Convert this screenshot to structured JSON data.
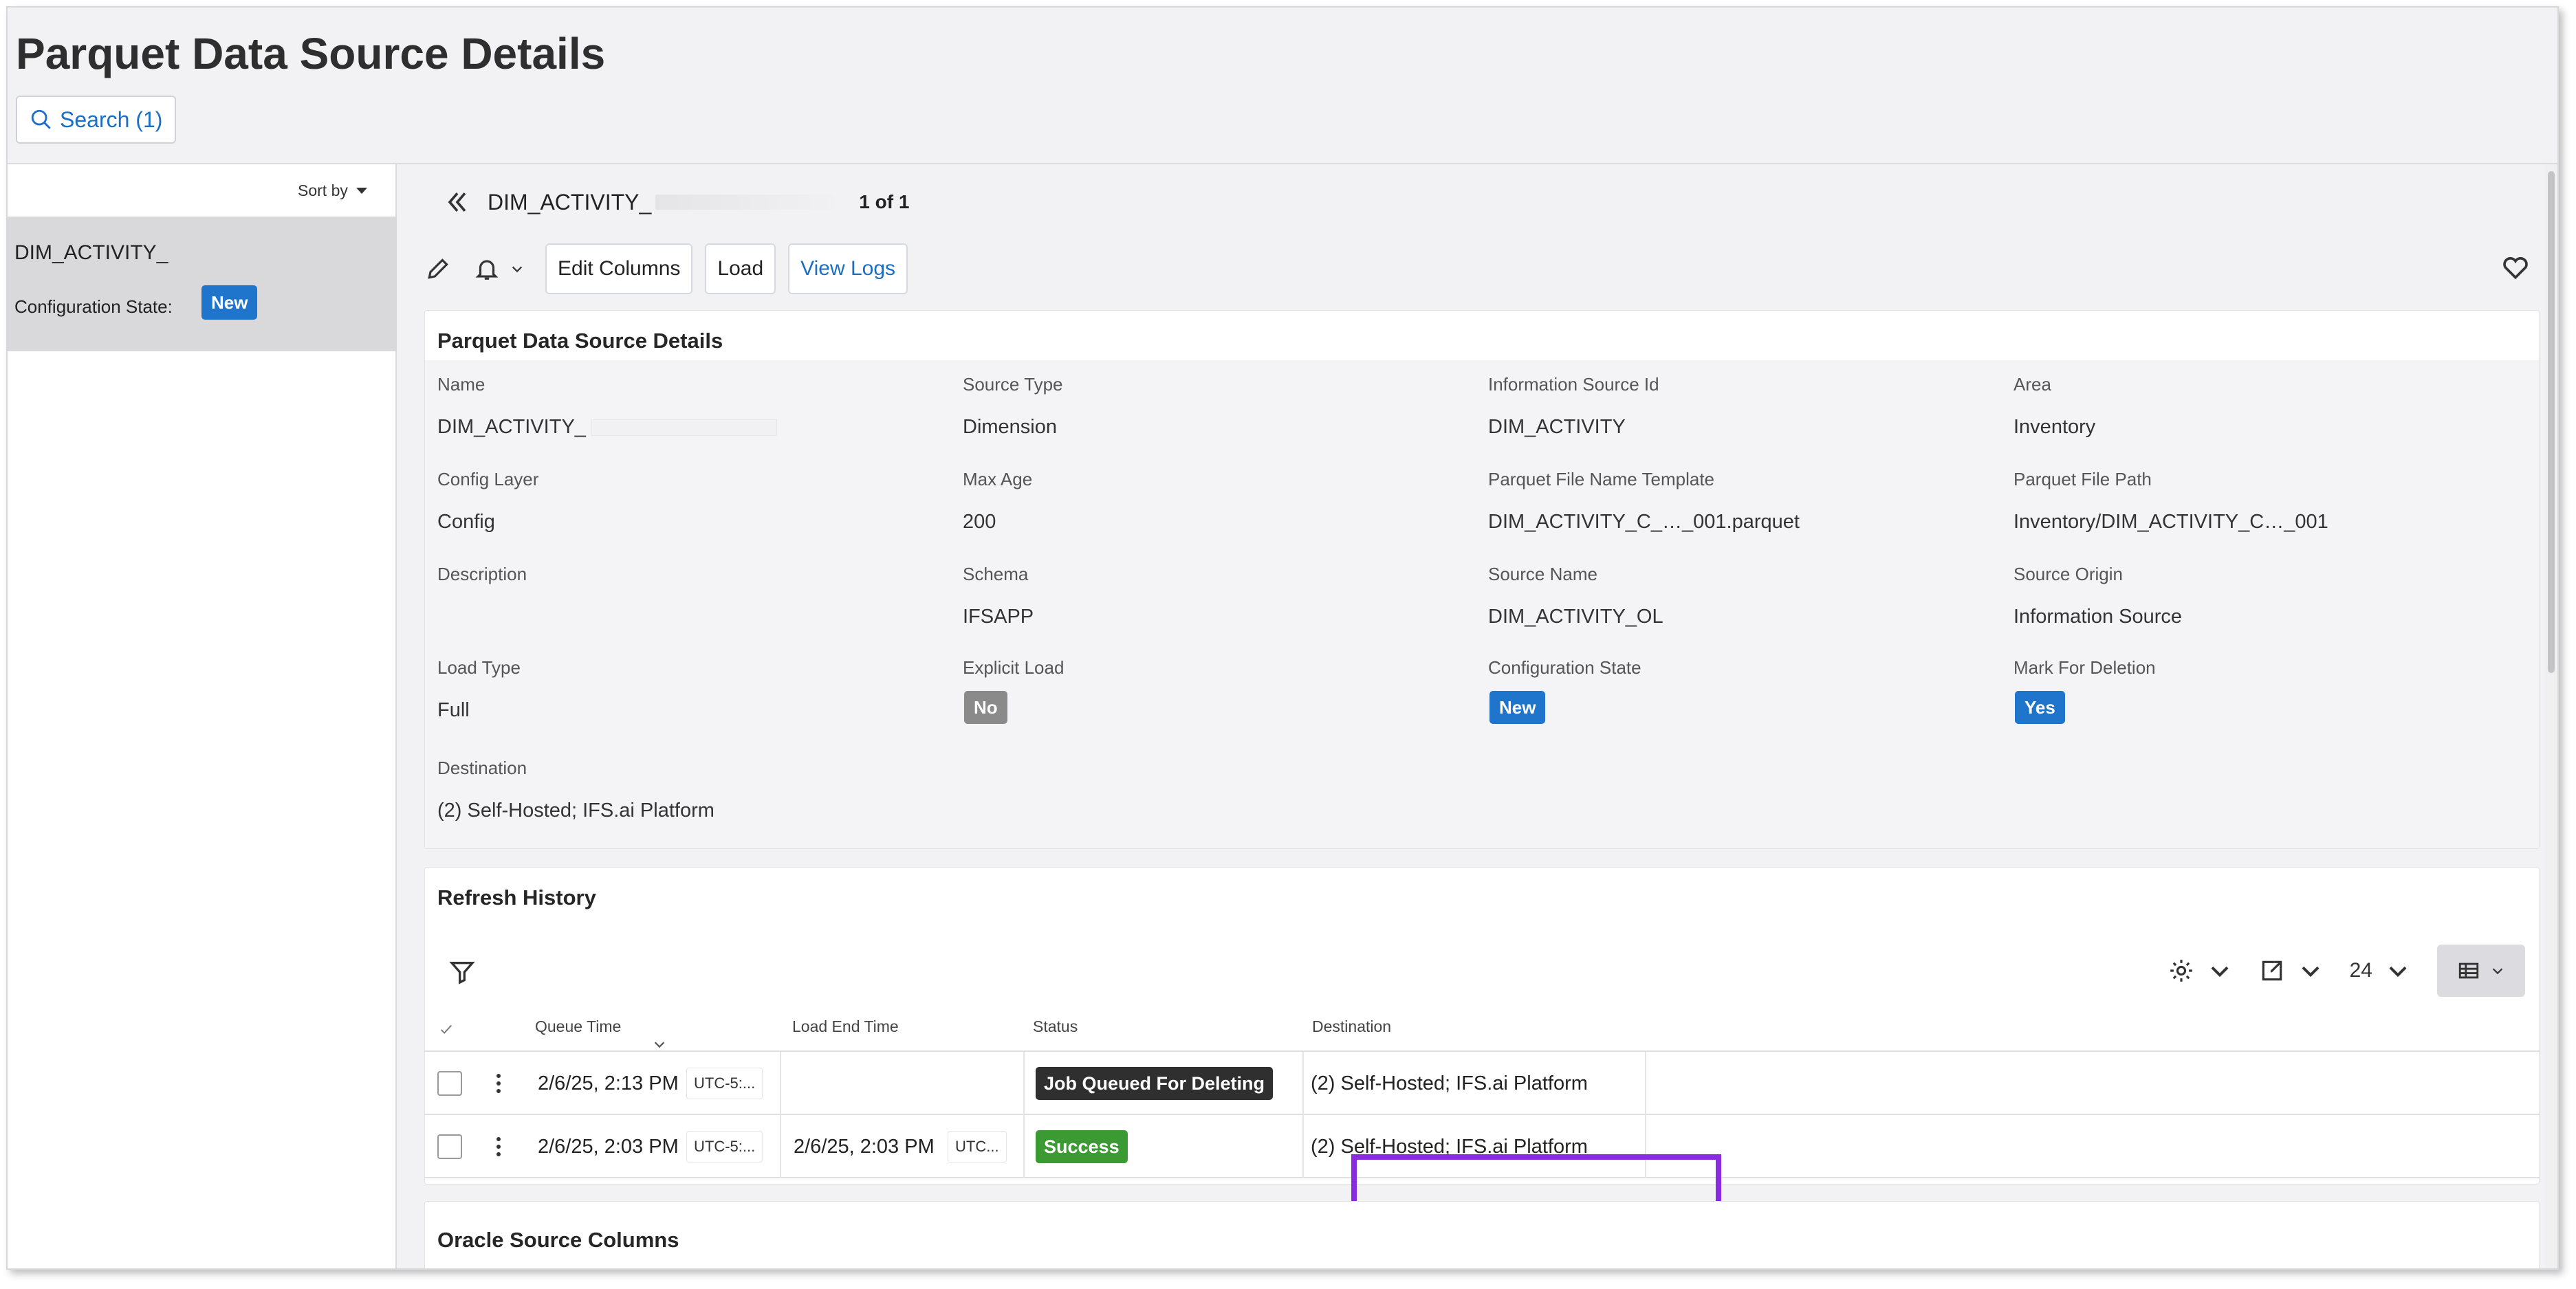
{
  "page": {
    "title": "Parquet Data Source Details",
    "search_label": "Search (1)"
  },
  "left_panel": {
    "sort_label": "Sort by",
    "items": [
      {
        "name": "DIM_ACTIVITY_",
        "state_label": "Configuration State:",
        "state_value": "New"
      }
    ]
  },
  "record_nav": {
    "record_name": "DIM_ACTIVITY_",
    "pager": "1 of 1"
  },
  "toolbar": {
    "edit_columns": "Edit Columns",
    "load": "Load",
    "view_logs": "View Logs"
  },
  "details": {
    "title": "Parquet Data Source Details",
    "fields": {
      "name": {
        "label": "Name",
        "value": "DIM_ACTIVITY_"
      },
      "source_type": {
        "label": "Source Type",
        "value": "Dimension"
      },
      "information_source_id": {
        "label": "Information Source Id",
        "value": "DIM_ACTIVITY"
      },
      "area": {
        "label": "Area",
        "value": "Inventory"
      },
      "config_layer": {
        "label": "Config Layer",
        "value": "Config"
      },
      "max_age": {
        "label": "Max Age",
        "value": "200"
      },
      "parquet_file_name_template": {
        "label": "Parquet File Name Template",
        "value": "DIM_ACTIVITY_C_…_001.parquet"
      },
      "parquet_file_path": {
        "label": "Parquet File Path",
        "value": "Inventory/DIM_ACTIVITY_C…_001"
      },
      "description": {
        "label": "Description",
        "value": ""
      },
      "schema": {
        "label": "Schema",
        "value": "IFSAPP"
      },
      "source_name": {
        "label": "Source Name",
        "value": "DIM_ACTIVITY_OL"
      },
      "source_origin": {
        "label": "Source Origin",
        "value": "Information Source"
      },
      "load_type": {
        "label": "Load Type",
        "value": "Full"
      },
      "explicit_load": {
        "label": "Explicit Load",
        "value": "No"
      },
      "configuration_state": {
        "label": "Configuration State",
        "value": "New"
      },
      "mark_for_deletion": {
        "label": "Mark For Deletion",
        "value": "Yes"
      },
      "destination": {
        "label": "Destination",
        "value": "(2) Self-Hosted; IFS.ai Platform"
      }
    }
  },
  "refresh_history": {
    "title": "Refresh History",
    "page_size": "24",
    "columns": [
      "Queue Time",
      "Load End Time",
      "Status",
      "Destination"
    ],
    "rows": [
      {
        "queue_time": "2/6/25, 2:13 PM",
        "queue_tz": "UTC-5:...",
        "load_end_time": "",
        "load_end_tz": "",
        "status": "Job Queued For Deleting",
        "destination": "(2) Self-Hosted; IFS.ai Platform"
      },
      {
        "queue_time": "2/6/25, 2:03 PM",
        "queue_tz": "UTC-5:...",
        "load_end_time": "2/6/25, 2:03 PM",
        "load_end_tz": "UTC...",
        "status": "Success",
        "destination": "(2) Self-Hosted; IFS.ai Platform"
      }
    ]
  },
  "oracle_columns": {
    "title": "Oracle Source Columns"
  },
  "colors": {
    "accent_blue": "#1f75cb",
    "link_blue": "#1a6fc4",
    "success_green": "#3c9a32",
    "queued_dark": "#2f2f2f",
    "highlight_purple": "#8a2be2"
  }
}
